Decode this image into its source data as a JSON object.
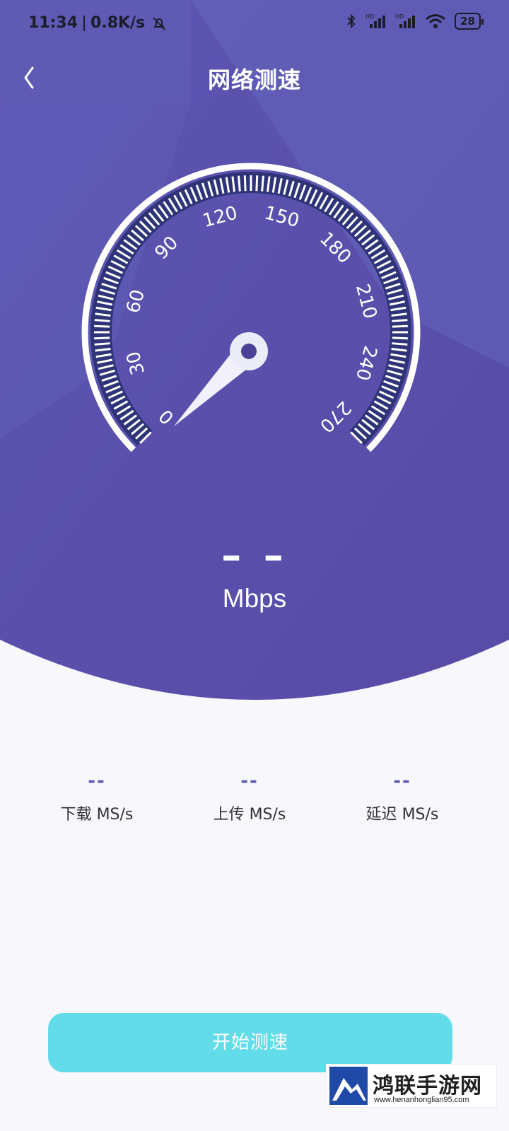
{
  "status_bar": {
    "time": "11:34",
    "net_speed": "0.8K/s",
    "battery": "28",
    "icons": [
      "mute-bell-icon",
      "bluetooth-icon",
      "signal-hd-icon",
      "signal-hd-icon",
      "wifi-icon",
      "battery-icon"
    ]
  },
  "header": {
    "title": "网络测速",
    "back_icon": "chevron-left-icon"
  },
  "gauge": {
    "tick_labels": [
      "0",
      "30",
      "60",
      "90",
      "120",
      "150",
      "180",
      "210",
      "240",
      "270"
    ],
    "needle_value": 0
  },
  "speed": {
    "value": "– –",
    "unit": "Mbps"
  },
  "stats": [
    {
      "value": "--",
      "label": "下载  MS/s"
    },
    {
      "value": "--",
      "label": "上传  MS/s"
    },
    {
      "value": "--",
      "label": "延迟  MS/s"
    }
  ],
  "start_button": {
    "label": "开始测速"
  },
  "watermark": {
    "text": "鸿联手游网",
    "url": "www.henanhonglian95.com"
  },
  "colors": {
    "hero_bg": "#5a4ea8",
    "accent_purple": "#5f58b8",
    "button_cyan": "#61dce8",
    "page_bg": "#f7f7fc"
  }
}
